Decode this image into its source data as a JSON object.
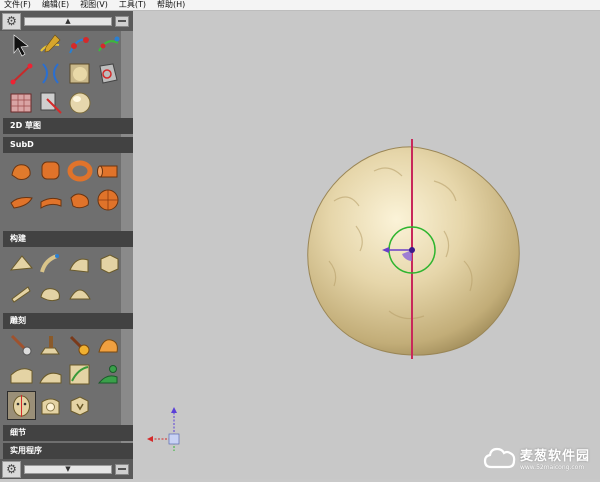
{
  "menu": [
    "文件(F)",
    "编辑(E)",
    "视图(V)",
    "工具(T)",
    "帮助(H)"
  ],
  "palette": {
    "top_arrow": "▲",
    "bottom_arrow": "▼",
    "sections": [
      "2D 草图",
      "SubD",
      "构建",
      "雕刻",
      "细节",
      "实用程序"
    ]
  },
  "watermark": {
    "name": "麦葱软件园",
    "url": "www.52maicong.com"
  },
  "colors": {
    "sphere": "#e2d3a8",
    "axis_line": "#c8285a",
    "gizmo_ring": "#2fb52f",
    "gizmo_arrow": "#6a3fc8",
    "section_header": "#424242"
  }
}
